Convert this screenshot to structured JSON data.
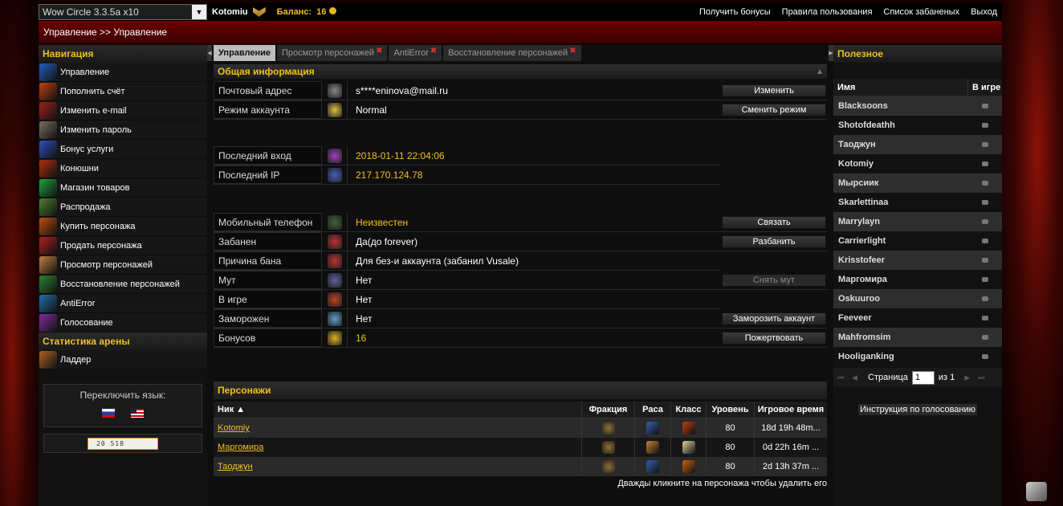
{
  "topbar": {
    "realm": "Wow Circle 3.3.5a x10",
    "realm_arrow": "▼",
    "user": "Kotomiu",
    "balance_label": "Баланс:",
    "balance_value": "16",
    "links": [
      "Получить бонусы",
      "Правила пользования",
      "Список забаненых",
      "Выход"
    ]
  },
  "breadcrumb": "Управление >> Управление",
  "left": {
    "nav_title": "Навигация",
    "nav_items": [
      {
        "label": "Управление",
        "icon": "control-icon",
        "color": "#2060c0"
      },
      {
        "label": "Пополнить счёт",
        "icon": "payment-icon",
        "color": "#c04010"
      },
      {
        "label": "Изменить e-mail",
        "icon": "email-icon",
        "color": "#a02020"
      },
      {
        "label": "Изменить пароль",
        "icon": "password-icon",
        "color": "#7a7060"
      },
      {
        "label": "Бонус услуги",
        "icon": "bonus-icon",
        "color": "#3050c0"
      },
      {
        "label": "Конюшни",
        "icon": "stable-icon",
        "color": "#b03010"
      },
      {
        "label": "Магазин товаров",
        "icon": "shop-icon",
        "color": "#20a040"
      },
      {
        "label": "Распродажа",
        "icon": "sale-icon",
        "color": "#508030"
      },
      {
        "label": "Купить персонажа",
        "icon": "buy-character-icon",
        "color": "#c05010"
      },
      {
        "label": "Продать персонажа",
        "icon": "sell-character-icon",
        "color": "#b02020"
      },
      {
        "label": "Просмотр персонажей",
        "icon": "view-characters-icon",
        "color": "#c08040"
      },
      {
        "label": "Восстановление персонажей",
        "icon": "restore-icon",
        "color": "#308030"
      },
      {
        "label": "AntiError",
        "icon": "antierror-icon",
        "color": "#2070b0"
      },
      {
        "label": "Голосование",
        "icon": "vote-icon",
        "color": "#8030a0"
      }
    ],
    "arena_title": "Статистика арены",
    "arena_items": [
      {
        "label": "Ладдер",
        "icon": "ladder-icon",
        "color": "#b06020"
      }
    ],
    "lang_title": "Переключить язык:",
    "counter": "20 518"
  },
  "tabs": [
    {
      "label": "Управление",
      "active": true
    },
    {
      "label": "Просмотр персонажей",
      "closable": true
    },
    {
      "label": "AntiError",
      "closable": true
    },
    {
      "label": "Восстановление персонажей",
      "closable": true
    }
  ],
  "general": {
    "title": "Общая информация",
    "rows1": [
      {
        "label": "Почтовый адрес",
        "value": "s****eninova@mail.ru",
        "button": "Изменить",
        "icon": "mail-icon",
        "color": "#888888"
      },
      {
        "label": "Режим аккаунта",
        "value": "Normal",
        "button": "Сменить режим",
        "icon": "star-icon",
        "color": "#e0c040"
      }
    ],
    "rows2": [
      {
        "label": "Последний вход",
        "value": "2018-01-11 22:04:06",
        "icon": "login-icon",
        "color": "#a040c0",
        "gold": true
      },
      {
        "label": "Последний IP",
        "value": "217.170.124.78",
        "icon": "ip-icon",
        "color": "#4060c0",
        "gold": true
      }
    ],
    "rows3": [
      {
        "label": "Мобильный телефон",
        "value": "Неизвестен",
        "button": "Связать",
        "icon": "phone-icon",
        "color": "#406040",
        "gold": true
      },
      {
        "label": "Забанен",
        "value": "Да(до forever)",
        "button": "Разбанить",
        "icon": "ban-icon",
        "color": "#c03030"
      },
      {
        "label": "Причина бана",
        "value": "Для без-и аккаунта (забанил Vusale)",
        "icon": "ban-reason-icon",
        "color": "#c03030"
      },
      {
        "label": "Мут",
        "value": "Нет",
        "button": "Снять мут",
        "button_disabled": true,
        "icon": "mute-icon",
        "color": "#6060a0"
      },
      {
        "label": "В игре",
        "value": "Нет",
        "icon": "ingame-icon",
        "color": "#c04020"
      },
      {
        "label": "Заморожен",
        "value": "Нет",
        "button": "Заморозить аккаунт",
        "icon": "freeze-icon",
        "color": "#60a0d0"
      },
      {
        "label": "Бонусов",
        "value": "16",
        "button": "Пожертвовать",
        "icon": "coin-icon",
        "color": "#e0b020",
        "gold": true
      }
    ]
  },
  "characters": {
    "title": "Персонажи",
    "columns": [
      "Ник ▲",
      "Фракция",
      "Раса",
      "Класс",
      "Уровень",
      "Игровое время"
    ],
    "rows": [
      {
        "name": "Kotomiy",
        "level": "80",
        "time": "18d 19h 48m...",
        "race_color": "#3060b0",
        "class_color": "#c04010"
      },
      {
        "name": "Маргомира",
        "level": "80",
        "time": "0d 22h 16m ...",
        "race_color": "#c08030",
        "class_color": "#e0d0a0"
      },
      {
        "name": "Таоджун",
        "level": "80",
        "time": "2d 13h 37m ...",
        "race_color": "#3060b0",
        "class_color": "#d06010"
      }
    ],
    "hint": "Дважды кликните на персонажа чтобы удалить его"
  },
  "right": {
    "title": "Полезное",
    "columns": [
      "Имя",
      "В игре"
    ],
    "players": [
      "Blacksoons",
      "Shotofdeathh",
      "Таоджун",
      "Kotomiy",
      "Мырсиик",
      "Skarlettinaa",
      "Marrylayn",
      "Carrierlight",
      "Krisstofeer",
      "Маргомира",
      "Oskuuroo",
      "Feeveer",
      "Mahfromsim",
      "Hooliganking"
    ],
    "pager_label": "Страница",
    "pager_value": "1",
    "pager_total": "из 1",
    "vote_button": "Инструкция по голосованию"
  }
}
